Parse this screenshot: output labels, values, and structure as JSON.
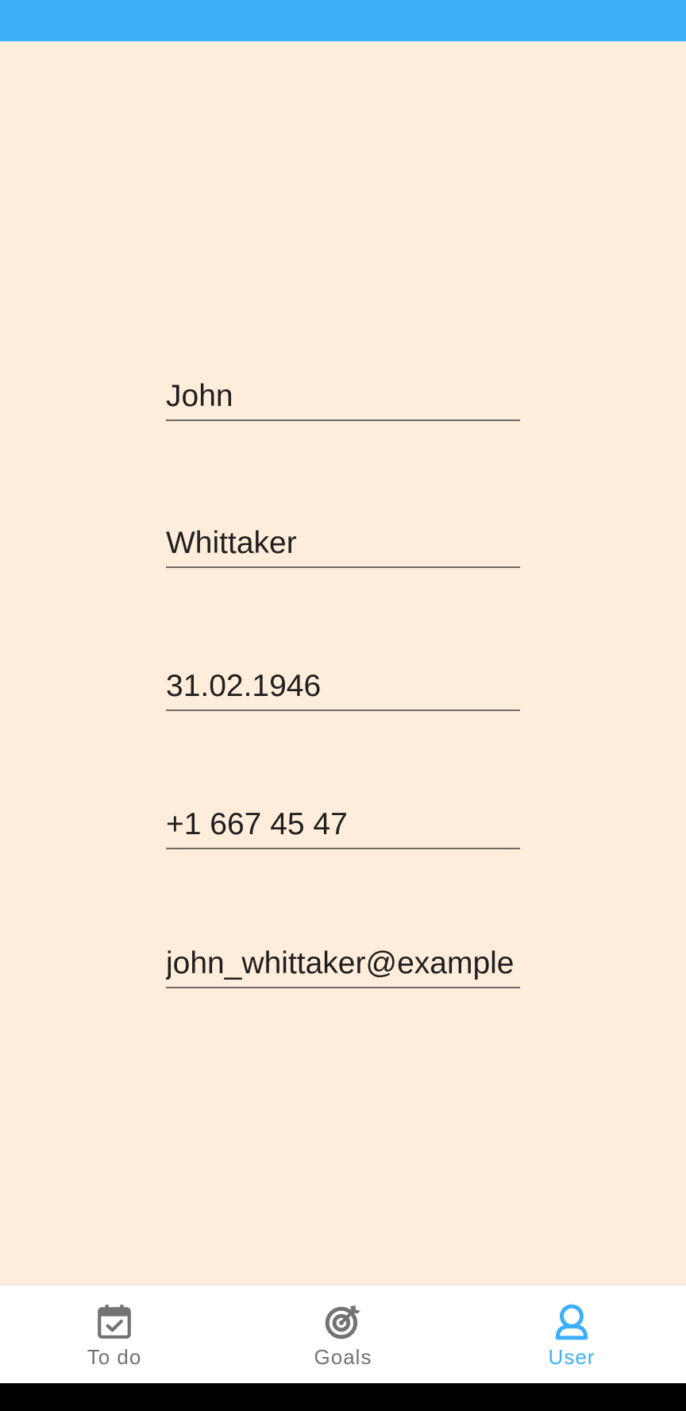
{
  "profile": {
    "first_name": "John",
    "last_name": "Whittaker",
    "birth_date": "31.02.1946",
    "phone": "+1 667 45 47",
    "email": "john_whittaker@example"
  },
  "nav": {
    "todo_label": "To do",
    "goals_label": "Goals",
    "user_label": "User",
    "active": "User"
  },
  "colors": {
    "accent": "#3daffa",
    "background": "#ffeddb",
    "nav_inactive": "#737373",
    "text": "#1f1f1f"
  },
  "icons": {
    "todo": "calendar-check-icon",
    "goals": "target-arrow-icon",
    "user": "user-icon"
  }
}
